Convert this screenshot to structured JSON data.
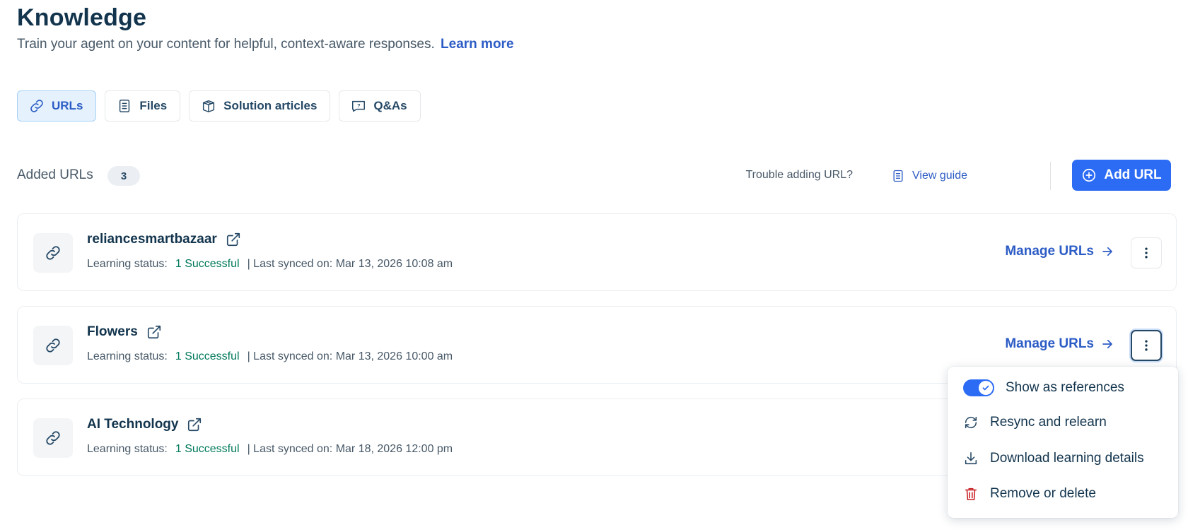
{
  "header": {
    "title": "Knowledge",
    "subtitle": "Train your agent on your content for helpful, context-aware responses.",
    "learn_more": "Learn more"
  },
  "tabs": [
    {
      "label": "URLs",
      "icon": "link-icon",
      "active": true
    },
    {
      "label": "Files",
      "icon": "file-icon",
      "active": false
    },
    {
      "label": "Solution articles",
      "icon": "book-icon",
      "active": false
    },
    {
      "label": "Q&As",
      "icon": "question-bubble-icon",
      "active": false
    }
  ],
  "list": {
    "label": "Added URLs",
    "count": "3",
    "trouble_text": "Trouble adding URL?",
    "view_guide": "View guide",
    "add_button": "Add URL"
  },
  "sources": [
    {
      "name": "reliancesmartbazaar",
      "status_label": "Learning status:",
      "status_value": "1 Successful",
      "synced": "| Last synced on: Mar 13, 2026 10:08 am",
      "manage": "Manage URLs"
    },
    {
      "name": "Flowers",
      "status_label": "Learning status:",
      "status_value": "1 Successful",
      "synced": "| Last synced on: Mar 13, 2026 10:00 am",
      "manage": "Manage URLs"
    },
    {
      "name": "AI Technology",
      "status_label": "Learning status:",
      "status_value": "1 Successful",
      "synced": "| Last synced on: Mar 18, 2026 12:00 pm",
      "manage": "Manage URLs"
    }
  ],
  "menu": {
    "show_references": "Show as references",
    "show_references_on": true,
    "resync": "Resync and relearn",
    "download": "Download learning details",
    "remove": "Remove or delete"
  },
  "colors": {
    "primary": "#2c6cf5",
    "link": "#2c5cc5",
    "success": "#00795b",
    "danger": "#c82124",
    "heading": "#12344d"
  }
}
